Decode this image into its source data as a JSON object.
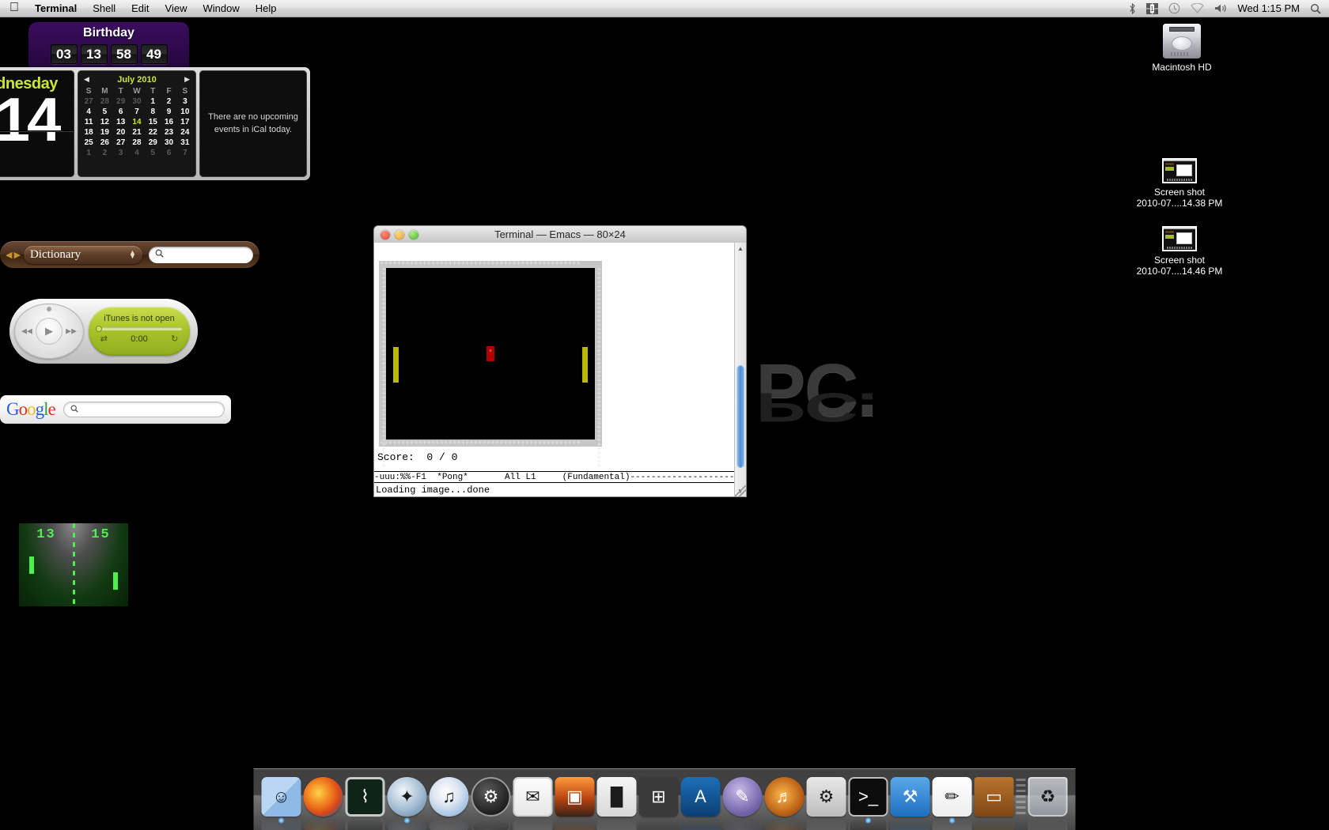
{
  "menubar": {
    "apple": "apple-logo",
    "items": [
      {
        "label": "Terminal",
        "bold": true
      },
      {
        "label": "Shell",
        "bold": false
      },
      {
        "label": "Edit",
        "bold": false
      },
      {
        "label": "View",
        "bold": false
      },
      {
        "label": "Window",
        "bold": false
      },
      {
        "label": "Help",
        "bold": false
      }
    ],
    "status_icons": [
      "bluetooth-icon",
      "keyboard-input-icon",
      "time-machine-icon",
      "wifi-icon",
      "volume-icon"
    ],
    "clock": "Wed 1:15 PM",
    "spotlight": "search-icon"
  },
  "widgets": {
    "birthday": {
      "title": "Birthday",
      "digits": [
        "03",
        "13",
        "58",
        "49"
      ]
    },
    "ical": {
      "dayname": "dnesday",
      "daynum": "14",
      "month": "July 2010",
      "prev": "◀",
      "next": "▶",
      "weekdays": [
        "S",
        "M",
        "T",
        "W",
        "T",
        "F",
        "S"
      ],
      "weeks": [
        [
          {
            "d": "27",
            "t": "dim"
          },
          {
            "d": "28",
            "t": "dim"
          },
          {
            "d": "29",
            "t": "dim"
          },
          {
            "d": "30",
            "t": "dim"
          },
          {
            "d": "1",
            "t": ""
          },
          {
            "d": "2",
            "t": ""
          },
          {
            "d": "3",
            "t": ""
          }
        ],
        [
          {
            "d": "4",
            "t": ""
          },
          {
            "d": "5",
            "t": ""
          },
          {
            "d": "6",
            "t": ""
          },
          {
            "d": "7",
            "t": ""
          },
          {
            "d": "8",
            "t": ""
          },
          {
            "d": "9",
            "t": ""
          },
          {
            "d": "10",
            "t": ""
          }
        ],
        [
          {
            "d": "11",
            "t": ""
          },
          {
            "d": "12",
            "t": ""
          },
          {
            "d": "13",
            "t": ""
          },
          {
            "d": "14",
            "t": "today"
          },
          {
            "d": "15",
            "t": ""
          },
          {
            "d": "16",
            "t": ""
          },
          {
            "d": "17",
            "t": ""
          }
        ],
        [
          {
            "d": "18",
            "t": ""
          },
          {
            "d": "19",
            "t": ""
          },
          {
            "d": "20",
            "t": ""
          },
          {
            "d": "21",
            "t": ""
          },
          {
            "d": "22",
            "t": ""
          },
          {
            "d": "23",
            "t": ""
          },
          {
            "d": "24",
            "t": ""
          }
        ],
        [
          {
            "d": "25",
            "t": ""
          },
          {
            "d": "26",
            "t": ""
          },
          {
            "d": "27",
            "t": ""
          },
          {
            "d": "28",
            "t": ""
          },
          {
            "d": "29",
            "t": ""
          },
          {
            "d": "30",
            "t": ""
          },
          {
            "d": "31",
            "t": ""
          }
        ],
        [
          {
            "d": "1",
            "t": "dim"
          },
          {
            "d": "2",
            "t": "dim"
          },
          {
            "d": "3",
            "t": "dim"
          },
          {
            "d": "4",
            "t": "dim"
          },
          {
            "d": "5",
            "t": "dim"
          },
          {
            "d": "6",
            "t": "dim"
          },
          {
            "d": "7",
            "t": "dim"
          }
        ]
      ],
      "events_text": "There are no upcoming events in iCal today."
    },
    "dictionary": {
      "mode_label": "Dictionary",
      "search_value": "",
      "search_placeholder": "",
      "back_icon": "◀",
      "forward_icon": "▶",
      "search_icon": "⌕"
    },
    "itunes": {
      "status": "iTunes is not open",
      "time": "0:00",
      "shuffle_icon": "⇄",
      "repeat_icon": "↻",
      "play_icon": "▶",
      "prev_icon": "◀◀",
      "next_icon": "▶▶"
    },
    "google": {
      "logo": [
        "G",
        "o",
        "o",
        "g",
        "l",
        "e"
      ],
      "search_value": "",
      "search_icon": "⌕"
    },
    "pong_widget": {
      "score_left": "13",
      "score_right": "15"
    }
  },
  "terminal": {
    "title": "Terminal — Emacs — 80×24",
    "traffic": {
      "close": "close-button",
      "minimize": "minimize-button",
      "zoom": "zoom-button"
    },
    "emacs": {
      "score_line": "Score:  0 / 0",
      "modeline": "-uuu:%%-F1  *Pong*       All L1     (Fundamental)---------------------------------",
      "minibuffer": "Loading image...done",
      "border_row": "+++++++++++++++++++++++++++++++++++++++++++++++",
      "game": {
        "ball_char": "*",
        "left_paddle": "paddle-left",
        "right_paddle": "paddle-right",
        "score_left": 0,
        "score_right": 0
      }
    },
    "scrollbar": {
      "up": "▲",
      "down": "▼"
    }
  },
  "desktop_icons": [
    {
      "name": "Macintosh HD",
      "type": "hd",
      "label": "Macintosh HD",
      "line2": ""
    },
    {
      "name": "screenshot-1",
      "type": "shot",
      "label": "Screen shot",
      "line2": "2010-07....14.38 PM"
    },
    {
      "name": "screenshot-2",
      "type": "shot",
      "label": "Screen shot",
      "line2": "2010-07....14.46 PM"
    }
  ],
  "wallpaper": {
    "text": "a PC."
  },
  "dock": {
    "items": [
      {
        "name": "finder",
        "label": "Finder",
        "cls": "ic-finder",
        "glyph": "☺",
        "dark": true,
        "running": true
      },
      {
        "name": "firefox",
        "label": "Firefox",
        "cls": "ic-firefox",
        "glyph": "",
        "dark": false,
        "running": false
      },
      {
        "name": "activity-monitor",
        "label": "Activity Monitor",
        "cls": "ic-activity",
        "glyph": "⌇",
        "dark": false,
        "running": false
      },
      {
        "name": "safari",
        "label": "Safari",
        "cls": "ic-safari",
        "glyph": "✦",
        "dark": true,
        "running": true
      },
      {
        "name": "itunes",
        "label": "iTunes",
        "cls": "ic-itunes",
        "glyph": "♫",
        "dark": true,
        "running": false
      },
      {
        "name": "dashboard",
        "label": "Dashboard",
        "cls": "ic-dash",
        "glyph": "⚙",
        "dark": false,
        "running": false
      },
      {
        "name": "mail",
        "label": "Mail",
        "cls": "ic-mail",
        "glyph": "✉",
        "dark": true,
        "running": false
      },
      {
        "name": "iphoto",
        "label": "iPhoto",
        "cls": "ic-iphoto",
        "glyph": "▣",
        "dark": false,
        "running": false
      },
      {
        "name": "keynote",
        "label": "Keynote",
        "cls": "ic-keynote",
        "glyph": "█",
        "dark": true,
        "running": false
      },
      {
        "name": "spaces",
        "label": "Spaces",
        "cls": "ic-spaces",
        "glyph": "⊞",
        "dark": false,
        "running": false
      },
      {
        "name": "font-book",
        "label": "Font Book",
        "cls": "ic-font",
        "glyph": "A",
        "dark": false,
        "running": false
      },
      {
        "name": "applescript-editor",
        "label": "AppleScript Editor",
        "cls": "ic-script",
        "glyph": "✎",
        "dark": false,
        "running": false
      },
      {
        "name": "garageband",
        "label": "GarageBand",
        "cls": "ic-garage",
        "glyph": "♬",
        "dark": false,
        "running": false
      },
      {
        "name": "system-preferences",
        "label": "System Preferences",
        "cls": "ic-sysprefs",
        "glyph": "⚙",
        "dark": true,
        "running": false
      },
      {
        "name": "terminal",
        "label": "Terminal",
        "cls": "ic-terminal",
        "glyph": ">_",
        "dark": false,
        "running": true
      },
      {
        "name": "xcode",
        "label": "Xcode",
        "cls": "ic-xcode",
        "glyph": "⚒",
        "dark": false,
        "running": false
      },
      {
        "name": "textedit",
        "label": "TextEdit",
        "cls": "ic-textedit",
        "glyph": "✏",
        "dark": true,
        "running": true
      },
      {
        "name": "keynote-presenter",
        "label": "Keynote Presenter",
        "cls": "ic-keynotepres",
        "glyph": "▭",
        "dark": false,
        "running": false
      }
    ],
    "separator": "dock-separator",
    "trash": {
      "name": "trash",
      "label": "Trash",
      "glyph": "♻"
    }
  }
}
